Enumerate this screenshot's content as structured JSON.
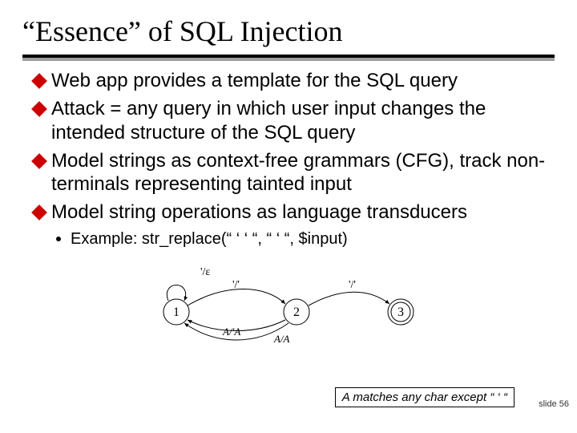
{
  "title": "“Essence” of SQL Injection",
  "bullets": [
    "Web app provides a template for the SQL query",
    "Attack = any query in which user input changes the intended structure of the SQL query",
    "Model strings as context-free grammars (CFG), track non-terminals representing tainted input",
    "Model string operations as language transducers"
  ],
  "sub_example": "Example: str_replace(“ ‘ ‘ “, “ ‘ “, $input)",
  "diagram": {
    "states": [
      "1",
      "2",
      "3"
    ],
    "edges": {
      "self1": "'/ε",
      "one_to_two": "'/'",
      "two_to_three": "'/'",
      "two_to_one": "A/'A",
      "two_to_one_alt": "A/A"
    }
  },
  "caption": "A matches any char except “ ‘ “",
  "footer": "slide 56"
}
